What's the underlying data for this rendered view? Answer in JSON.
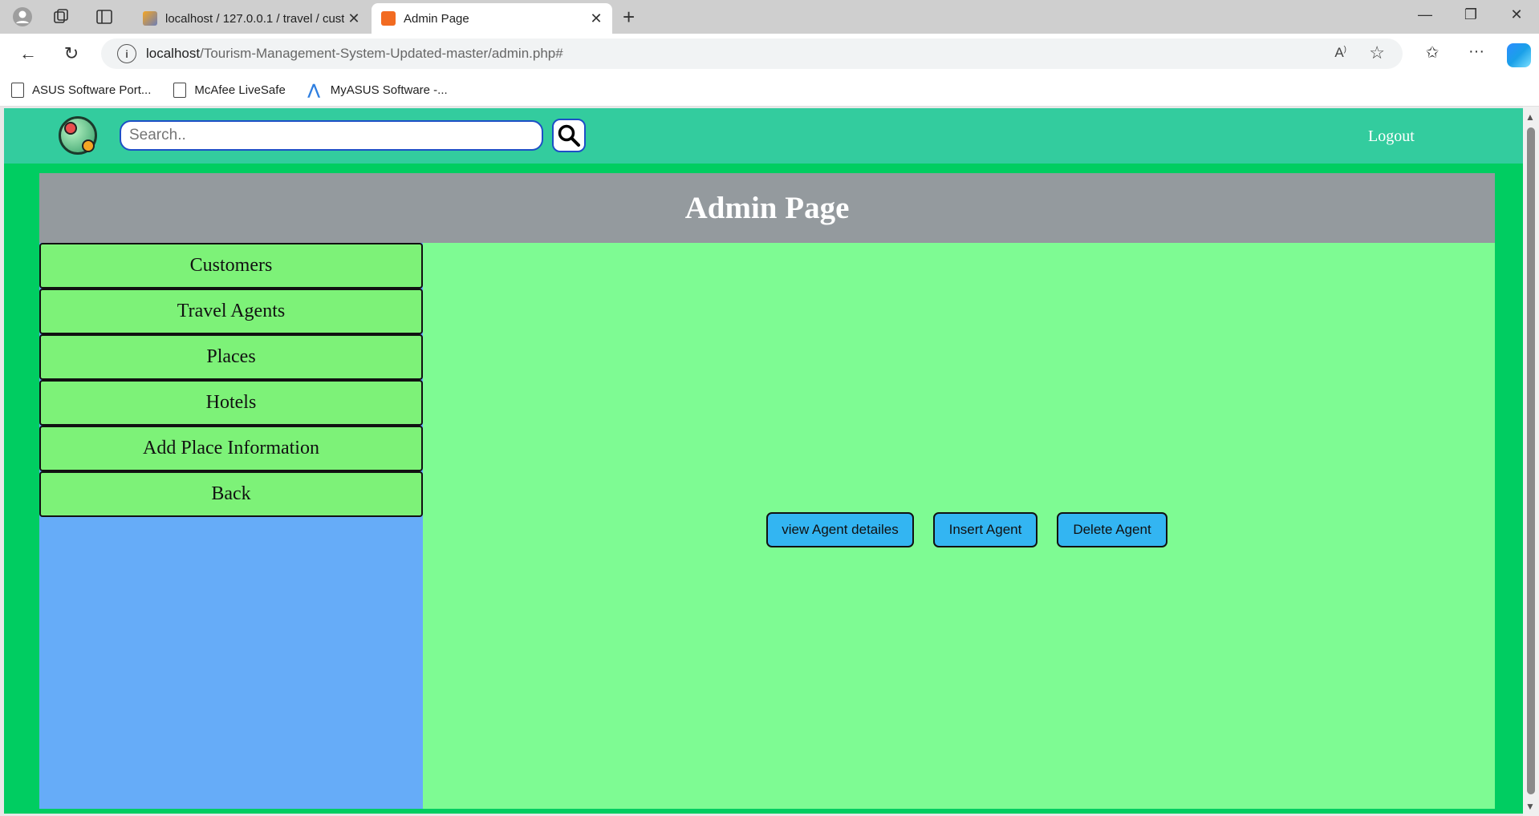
{
  "browser": {
    "tabs": [
      {
        "title": "localhost / 127.0.0.1 / travel / cust",
        "active": false
      },
      {
        "title": "Admin Page",
        "active": true
      }
    ],
    "address": {
      "host": "localhost",
      "path": "/Tourism-Management-System-Updated-master/admin.php#"
    },
    "bookmarks": [
      {
        "label": "ASUS Software Port...",
        "icon": "page-icon"
      },
      {
        "label": "McAfee LiveSafe",
        "icon": "page-icon"
      },
      {
        "label": "MyASUS Software -...",
        "icon": "asus-icon"
      }
    ]
  },
  "header": {
    "search_placeholder": "Search..",
    "logout_label": "Logout"
  },
  "admin": {
    "title": "Admin Page",
    "sidebar": [
      {
        "label": "Customers"
      },
      {
        "label": "Travel Agents"
      },
      {
        "label": "Places"
      },
      {
        "label": "Hotels"
      },
      {
        "label": "Add Place Information"
      },
      {
        "label": "Back"
      }
    ],
    "actions": [
      {
        "label": "view Agent detailes"
      },
      {
        "label": "Insert Agent"
      },
      {
        "label": "Delete Agent"
      }
    ]
  },
  "colors": {
    "page_bg": "#00cd61",
    "header_bg": "#33cc9e",
    "title_bar_bg": "#949a9e",
    "sidebar_bg": "#66acf8",
    "sidebar_button_bg": "#7df278",
    "main_bg": "#7efb93",
    "action_button_bg": "#33b5f2"
  }
}
